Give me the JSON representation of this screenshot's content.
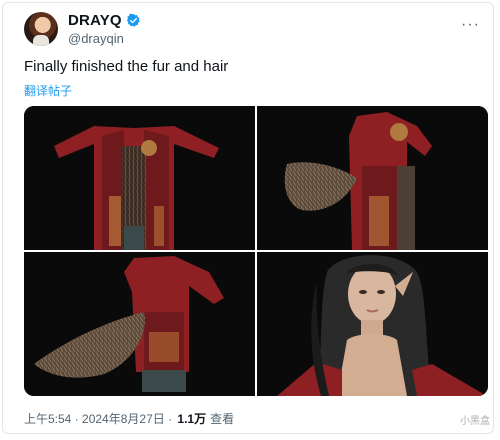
{
  "author": {
    "display_name": "DRAYQ",
    "handle": "@drayqin",
    "more_icon": "ellipsis-icon",
    "verified_color": "#1d9bf0"
  },
  "post": {
    "text": "Finally finished the fur and hair",
    "translate_label": "翻译帖子"
  },
  "media": {
    "images": [
      {
        "subject": "front view of red robe character"
      },
      {
        "subject": "side view with fur tail"
      },
      {
        "subject": "back view with fur tail"
      },
      {
        "subject": "close-up of character face and hair"
      }
    ]
  },
  "meta": {
    "time": "上午5:54",
    "separator": " · ",
    "date": "2024年8月27日",
    "views_count": "1.1万",
    "views_label": "查看"
  },
  "watermark": "小黑盒"
}
